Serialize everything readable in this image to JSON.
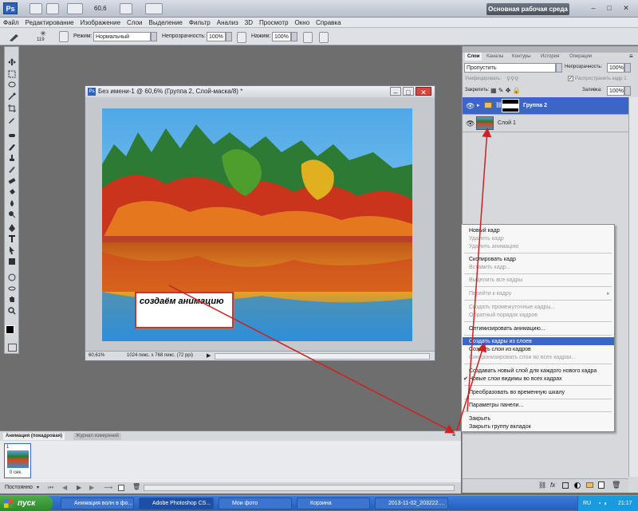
{
  "appbar": {
    "logo": "Ps",
    "zoom": "60,6",
    "workspace": "Основная рабочая среда"
  },
  "menu": [
    "Файл",
    "Редактирование",
    "Изображение",
    "Слои",
    "Выделение",
    "Фильтр",
    "Анализ",
    "3D",
    "Просмотр",
    "Окно",
    "Справка"
  ],
  "options": {
    "brush_size": "119",
    "mode_label": "Режим:",
    "mode_value": "Нормальный",
    "opacity_label": "Непрозрачность:",
    "opacity_value": "100%",
    "pressure_label": "Нажим:",
    "pressure_value": "100%"
  },
  "document": {
    "title": "Без имени-1 @ 60,6% (Группа 2, Слой-маска/8) *",
    "zoom": "60,61%",
    "info": "1024 пикс. x 768 пикс. (72 ppi)"
  },
  "callout": {
    "text": "создаём анимацию"
  },
  "layers": {
    "tabs": [
      "Слои",
      "Каналы",
      "Контуры",
      "История",
      "Операции"
    ],
    "blend_mode": "Пропустить",
    "opacity_label": "Непрозрачность:",
    "opacity_value": "100%",
    "lock_label": "Закрепить:",
    "fill_label": "Заливка:",
    "fill_value": "100%",
    "unify_label": "Унифицировать:",
    "propagate_label": "Распространить кадр 1",
    "items": [
      {
        "name": "Группа 2",
        "selected": true
      },
      {
        "name": "Слой 1",
        "selected": false
      }
    ]
  },
  "context_menu": {
    "items": [
      {
        "label": "Новый кадр",
        "disabled": false
      },
      {
        "label": "Удалить кадр",
        "disabled": true
      },
      {
        "label": "Удалить анимацию",
        "disabled": true
      },
      {
        "label": "Скопировать кадр",
        "disabled": false
      },
      {
        "label": "Вставить кадр...",
        "disabled": true
      },
      {
        "label": "Выделить все кадры",
        "disabled": true
      },
      {
        "label": "Перейти к кадру",
        "disabled": true
      },
      {
        "label": "Создать промежуточные кадры...",
        "disabled": true
      },
      {
        "label": "Обратный порядок кадров",
        "disabled": true
      },
      {
        "label": "Оптимизировать анимацию...",
        "disabled": false
      },
      {
        "label": "Создать кадры из слоев",
        "disabled": false,
        "highlighted": true
      },
      {
        "label": "Создать слои из кадров",
        "disabled": false
      },
      {
        "label": "Синхронизировать слои во всех кадрах...",
        "disabled": true
      },
      {
        "label": "Создавать новый слой для каждого нового кадра",
        "disabled": false
      },
      {
        "label": "Новые слои видимы во всех кадрах",
        "disabled": false,
        "checked": true
      },
      {
        "label": "Преобразовать во временную шкалу",
        "disabled": false
      },
      {
        "label": "Параметры панели...",
        "disabled": false
      },
      {
        "label": "Закрыть",
        "disabled": false
      },
      {
        "label": "Закрыть группу вкладок",
        "disabled": false
      }
    ]
  },
  "animation": {
    "tab_active": "Анимация (покадровая)",
    "tab_inactive": "Журнал измерений",
    "frame_number": "1",
    "frame_delay": "0 сек.",
    "loop": "Постоянно"
  },
  "taskbar": {
    "start": "пуск",
    "items": [
      {
        "label": "Анимация волн в фо...",
        "active": false
      },
      {
        "label": "Adobe Photoshop CS...",
        "active": true
      },
      {
        "label": "Мои фото",
        "active": false
      },
      {
        "label": "Корзина",
        "active": false
      },
      {
        "label": "2013-11-02_203222....",
        "active": false
      }
    ],
    "lang": "RU",
    "time": "21:17"
  },
  "colors": {
    "selection": "#3b66c8",
    "callout_border": "#cc3333",
    "arrow": "#cc2222"
  }
}
